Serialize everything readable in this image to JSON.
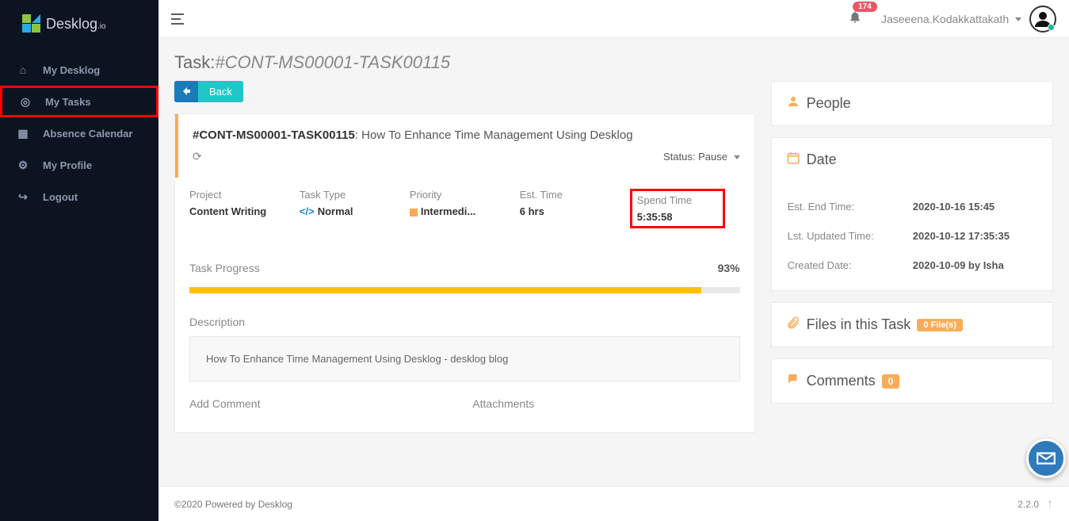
{
  "brand": {
    "name": "Desklog",
    "suffix": ".io"
  },
  "nav": {
    "items": [
      {
        "icon": "home",
        "label": "My Desklog"
      },
      {
        "icon": "target",
        "label": "My Tasks"
      },
      {
        "icon": "calendar",
        "label": "Absence Calendar"
      },
      {
        "icon": "gear",
        "label": "My Profile"
      },
      {
        "icon": "logout",
        "label": "Logout"
      }
    ]
  },
  "topbar": {
    "notif_count": "174",
    "username": "Jaseeena.Kodakkattakath"
  },
  "page": {
    "title_prefix": "Task:",
    "title_id": "#CONT-MS00001-TASK00115"
  },
  "back_label": "Back",
  "task": {
    "id": "#CONT-MS00001-TASK00115",
    "separator": ": ",
    "name": "How To Enhance Time Management Using Desklog",
    "status_label": "Status: ",
    "status_value": "Pause",
    "metrics": {
      "project": {
        "label": "Project",
        "value": "Content Writing"
      },
      "task_type": {
        "label": "Task Type",
        "value": "Normal"
      },
      "priority": {
        "label": "Priority",
        "value": "Intermedi..."
      },
      "est_time": {
        "label": "Est. Time",
        "value": "6 hrs"
      },
      "spend_time": {
        "label": "Spend Time",
        "value": "5:35:58"
      }
    },
    "progress": {
      "label": "Task Progress",
      "percent_text": "93%",
      "percent": 93
    },
    "description": {
      "label": "Description",
      "value": "How To Enhance Time Management Using Desklog - desklog blog"
    },
    "add_comment_label": "Add Comment",
    "attachments_label": "Attachments"
  },
  "panels": {
    "people": "People",
    "date": "Date",
    "date_rows": {
      "est_end": {
        "label": "Est. End Time:",
        "value": "2020-10-16 15:45"
      },
      "updated": {
        "label": "Lst. Updated Time:",
        "value": "2020-10-12 17:35:35"
      },
      "created": {
        "label": "Created Date:",
        "value": "2020-10-09 by Isha"
      }
    },
    "files": {
      "label": "Files in this Task",
      "count": "0 File(s)"
    },
    "comments": {
      "label": "Comments",
      "count": "0"
    }
  },
  "footer": {
    "copyright": "©2020 Powered by Desklog",
    "version": "2.2.0"
  }
}
